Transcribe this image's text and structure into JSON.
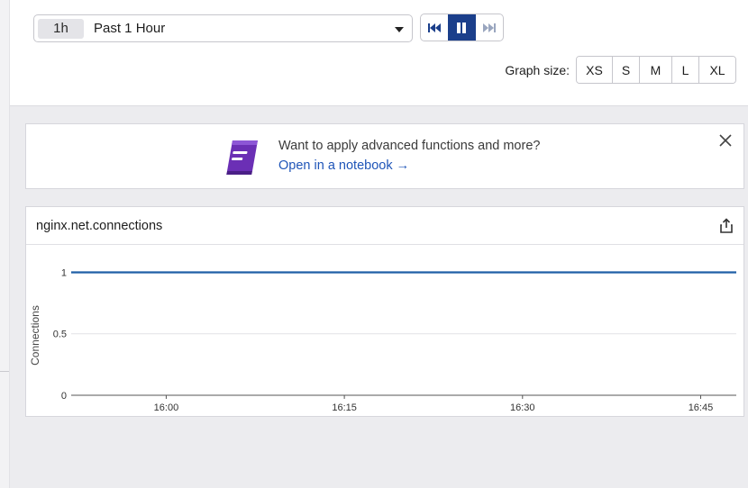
{
  "time_selector": {
    "badge": "1h",
    "label": "Past 1 Hour"
  },
  "playback": {
    "rewind_icon": "rewind-icon",
    "pause_icon": "pause-icon",
    "forward_icon": "fast-forward-icon"
  },
  "graph_size": {
    "label": "Graph size:",
    "options": [
      "XS",
      "S",
      "M",
      "L",
      "XL"
    ]
  },
  "banner": {
    "text": "Want to apply advanced functions and more?",
    "link": "Open in a notebook →",
    "icon": "notebook-icon",
    "icon_color": "#6b2fb5"
  },
  "card": {
    "title": "nginx.net.connections",
    "share_icon": "share-icon"
  },
  "colors": {
    "accent": "#1b3f8b",
    "series": "#1f5fa6",
    "link": "#1f55b8"
  },
  "chart_data": {
    "type": "line",
    "title": "",
    "xlabel": "",
    "ylabel": "Connections",
    "ylim": [
      0,
      1.15
    ],
    "y_ticks": [
      0,
      0.5,
      1
    ],
    "y_tick_labels": [
      "0",
      "0.5",
      "1"
    ],
    "x_ticks": [
      "16:00",
      "16:15",
      "16:30",
      "16:45"
    ],
    "x_range": [
      "15:52",
      "16:48"
    ],
    "grid": true,
    "series": [
      {
        "x": [
          "15:52",
          "16:00",
          "16:15",
          "16:30",
          "16:45",
          "16:48"
        ],
        "values": [
          1,
          1,
          1,
          1,
          1,
          1
        ]
      }
    ]
  }
}
